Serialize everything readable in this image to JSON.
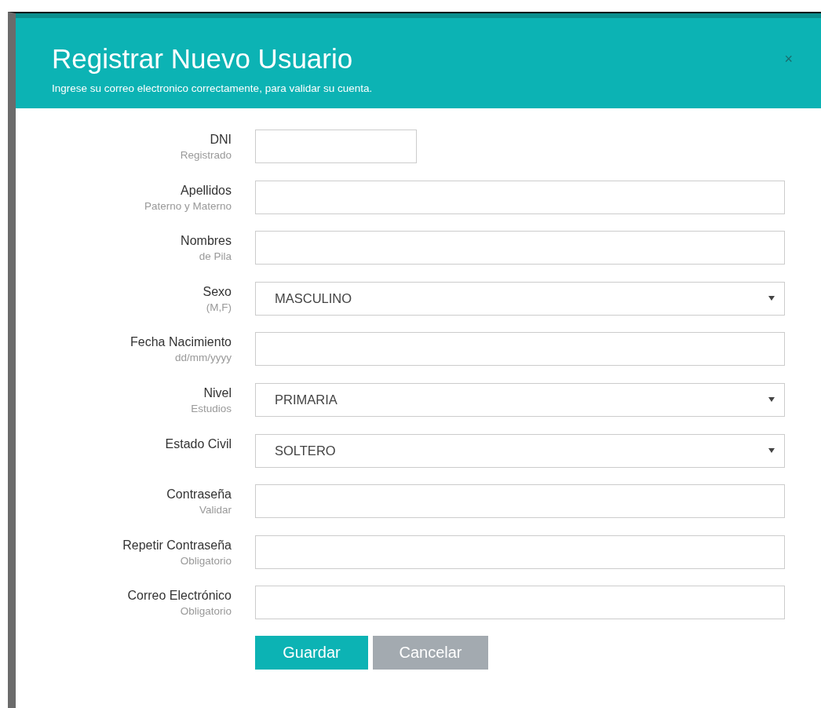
{
  "dialog": {
    "title": "Registrar Nuevo Usuario",
    "subtitle": "Ingrese su correo electronico correctamente, para validar su cuenta.",
    "close": "×"
  },
  "fields": [
    {
      "kind": "text",
      "label": "DNI",
      "hint": "Registrado",
      "narrow": true
    },
    {
      "kind": "text",
      "label": "Apellidos",
      "hint": "Paterno y Materno"
    },
    {
      "kind": "text",
      "label": "Nombres",
      "hint": "de Pila"
    },
    {
      "kind": "select",
      "label": "Sexo",
      "hint": "(M,F)",
      "value": "MASCULINO"
    },
    {
      "kind": "text",
      "label": "Fecha Nacimiento",
      "hint": "dd/mm/yyyy"
    },
    {
      "kind": "select",
      "label": "Nivel",
      "hint": "Estudios",
      "value": "PRIMARIA"
    },
    {
      "kind": "select",
      "label": "Estado Civil",
      "value": "SOLTERO"
    },
    {
      "kind": "text",
      "label": "Contraseña",
      "hint": "Validar"
    },
    {
      "kind": "text",
      "label": "Repetir Contraseña",
      "hint": "Obligatorio"
    },
    {
      "kind": "text",
      "label": "Correo Electrónico",
      "hint": "Obligatorio"
    }
  ],
  "buttons": [
    {
      "label": "Guardar",
      "kind": "primary"
    },
    {
      "label": "Cancelar",
      "kind": "secondary"
    }
  ]
}
